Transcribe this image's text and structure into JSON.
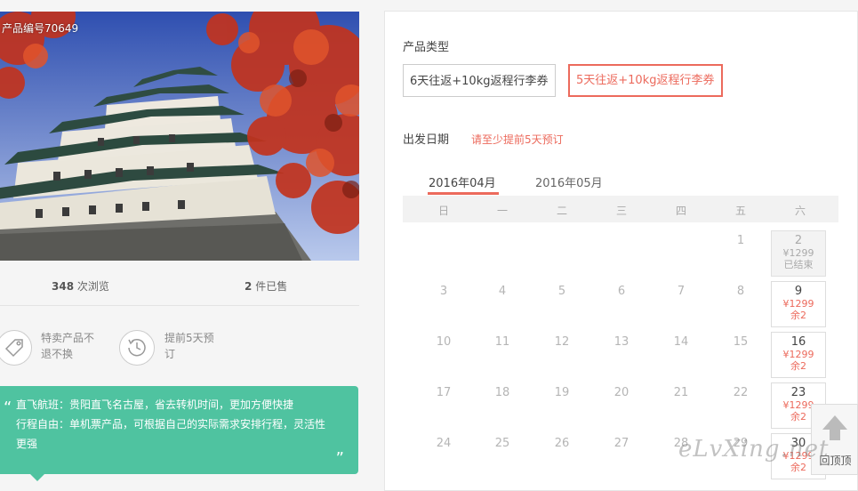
{
  "product": {
    "number_label": "产品编号70649",
    "views": {
      "count": "348",
      "label": "次浏览"
    },
    "sold": {
      "count": "2",
      "label": "件已售"
    },
    "features": [
      {
        "icon": "tag-icon",
        "line1": "特卖产品不",
        "line2": "退不换"
      },
      {
        "icon": "clock-icon",
        "line1": "提前5天预",
        "line2": "订"
      }
    ],
    "highlights": [
      "直飞航班：贵阳直飞名古屋，省去转机时间，更加方便快捷",
      "行程自由：单机票产品，可根据自己的实际需求安排行程，灵活性",
      "更强"
    ]
  },
  "booking": {
    "type_title": "产品类型",
    "types": [
      {
        "label": "6天往返+10kg返程行李券",
        "selected": false
      },
      {
        "label": "5天往返+10kg返程行李券",
        "selected": true
      }
    ],
    "date_title": "出发日期",
    "date_notice": "请至少提前5天预订",
    "months": [
      "2016年04月",
      "2016年05月"
    ],
    "active_month": "2016年04月",
    "weekdays": [
      "日",
      "一",
      "二",
      "三",
      "四",
      "五",
      "六"
    ],
    "rows": [
      [
        null,
        null,
        null,
        null,
        null,
        "1",
        {
          "day": "2",
          "price": "¥1299",
          "remain": "已结束",
          "past": true
        }
      ],
      [
        "3",
        "4",
        "5",
        "6",
        "7",
        "8",
        {
          "day": "9",
          "price": "¥1299",
          "remain": "余2",
          "past": false
        }
      ],
      [
        "10",
        "11",
        "12",
        "13",
        "14",
        "15",
        {
          "day": "16",
          "price": "¥1299",
          "remain": "余2",
          "past": false
        }
      ],
      [
        "17",
        "18",
        "19",
        "20",
        "21",
        "22",
        {
          "day": "23",
          "price": "¥1299",
          "remain": "余2",
          "past": false
        }
      ],
      [
        "24",
        "25",
        "26",
        "27",
        "28",
        "29",
        {
          "day": "30",
          "price": "¥1299",
          "remain": "余2",
          "past": false
        }
      ]
    ]
  },
  "back_to_top": {
    "label": "回顶顶"
  },
  "watermark": "eLvXing.net",
  "colors": {
    "accent": "#ec6a5c",
    "quote_bg": "#4fc3a0"
  }
}
